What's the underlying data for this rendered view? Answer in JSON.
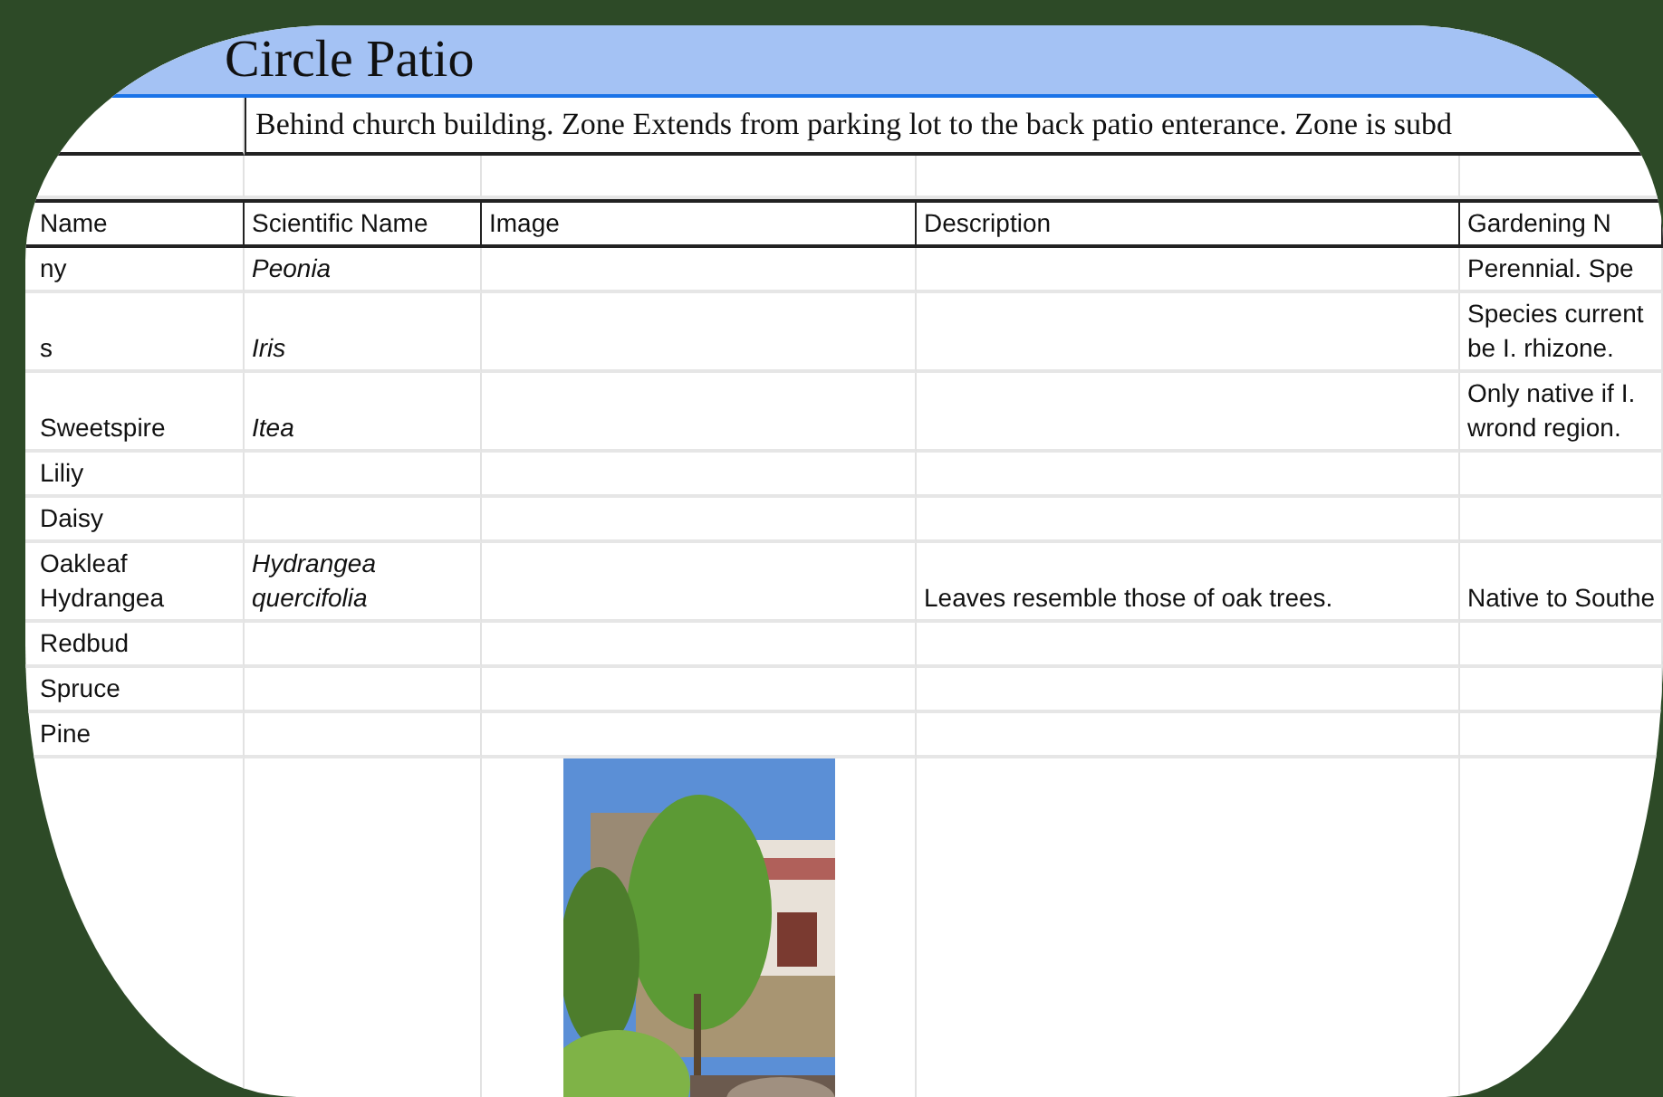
{
  "sheet": {
    "title": "Circle Patio",
    "zone_note": "Behind church building. Zone Extends from parking lot to the back patio enterance. Zone is subd",
    "columns": [
      "Name",
      "Scientific Name",
      "Image",
      "Description",
      "Gardening N"
    ],
    "rows": [
      {
        "name": "ny",
        "scientific": "Peonia",
        "notes": "Perennial. Spe"
      },
      {
        "name": "s",
        "scientific": "Iris",
        "notes": "Species current\nbe I. rhizone."
      },
      {
        "name": "Sweetspire",
        "scientific": "Itea",
        "notes": "Only native if I.\nwrond region."
      },
      {
        "name": "Liliy"
      },
      {
        "name": "Daisy"
      },
      {
        "name": "Oakleaf Hydrangea",
        "scientific": "Hydrangea quercifolia",
        "description": "Leaves resemble those of oak trees.",
        "notes": "Native to Southe"
      },
      {
        "name": "Redbud"
      },
      {
        "name": "Spruce"
      },
      {
        "name": "Pine"
      },
      {
        "image": {
          "kind": "picture"
        }
      }
    ]
  }
}
